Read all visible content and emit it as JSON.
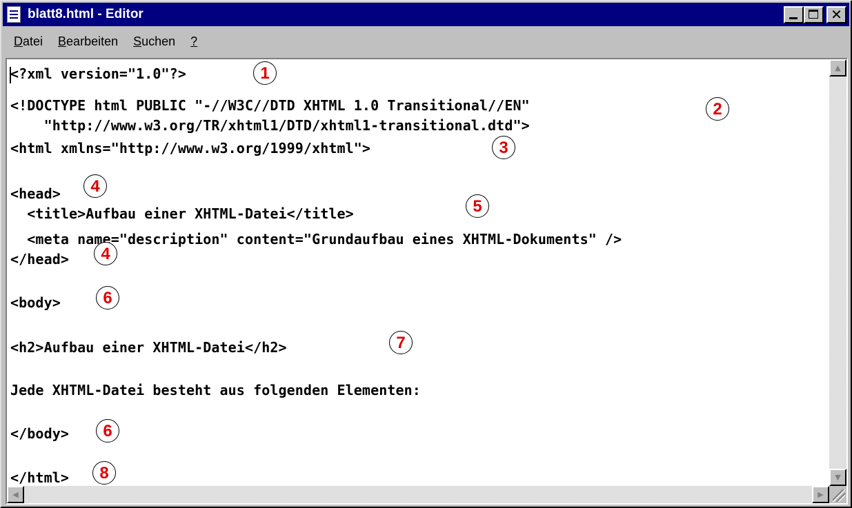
{
  "window": {
    "title": "blatt8.html - Editor"
  },
  "menu": {
    "items": [
      {
        "label": "Datei",
        "accel": "D",
        "rest": "atei"
      },
      {
        "label": "Bearbeiten",
        "accel": "B",
        "rest": "earbeiten"
      },
      {
        "label": "Suchen",
        "accel": "S",
        "rest": "uchen"
      },
      {
        "label": "?",
        "accel": "?",
        "rest": ""
      }
    ]
  },
  "icons": {
    "app": "notepad-icon",
    "minimize": "minimize-icon",
    "maximize": "maximize-icon",
    "close": "close-icon",
    "scroll_up": "arrow-up-icon",
    "scroll_down": "arrow-down-icon",
    "scroll_left": "arrow-left-icon",
    "scroll_right": "arrow-right-icon",
    "resize": "resize-grip-icon"
  },
  "colors": {
    "titlebar": "#000080",
    "callout_text": "#e00000",
    "editor_bg": "#ffffff",
    "chrome": "#c0c0c0"
  },
  "editor": {
    "lines": [
      "<?xml version=\"1.0\"?>",
      "<!DOCTYPE html PUBLIC \"-//W3C//DTD XHTML 1.0 Transitional//EN\"",
      "    \"http://www.w3.org/TR/xhtml1/DTD/xhtml1-transitional.dtd\">",
      "<html xmlns=\"http://www.w3.org/1999/xhtml\">",
      "<head>",
      "  <title>Aufbau einer XHTML-Datei</title>",
      "  <meta name=\"description\" content=\"Grundaufbau eines XHTML-Dokuments\" />",
      "</head>",
      "<body>",
      "<h2>Aufbau einer XHTML-Datei</h2>",
      "Jede XHTML-Datei besteht aus folgenden Elementen:",
      "</body>",
      "</html>"
    ]
  },
  "callouts": [
    "1",
    "2",
    "3",
    "4",
    "5",
    "4",
    "6",
    "7",
    "6",
    "8"
  ]
}
